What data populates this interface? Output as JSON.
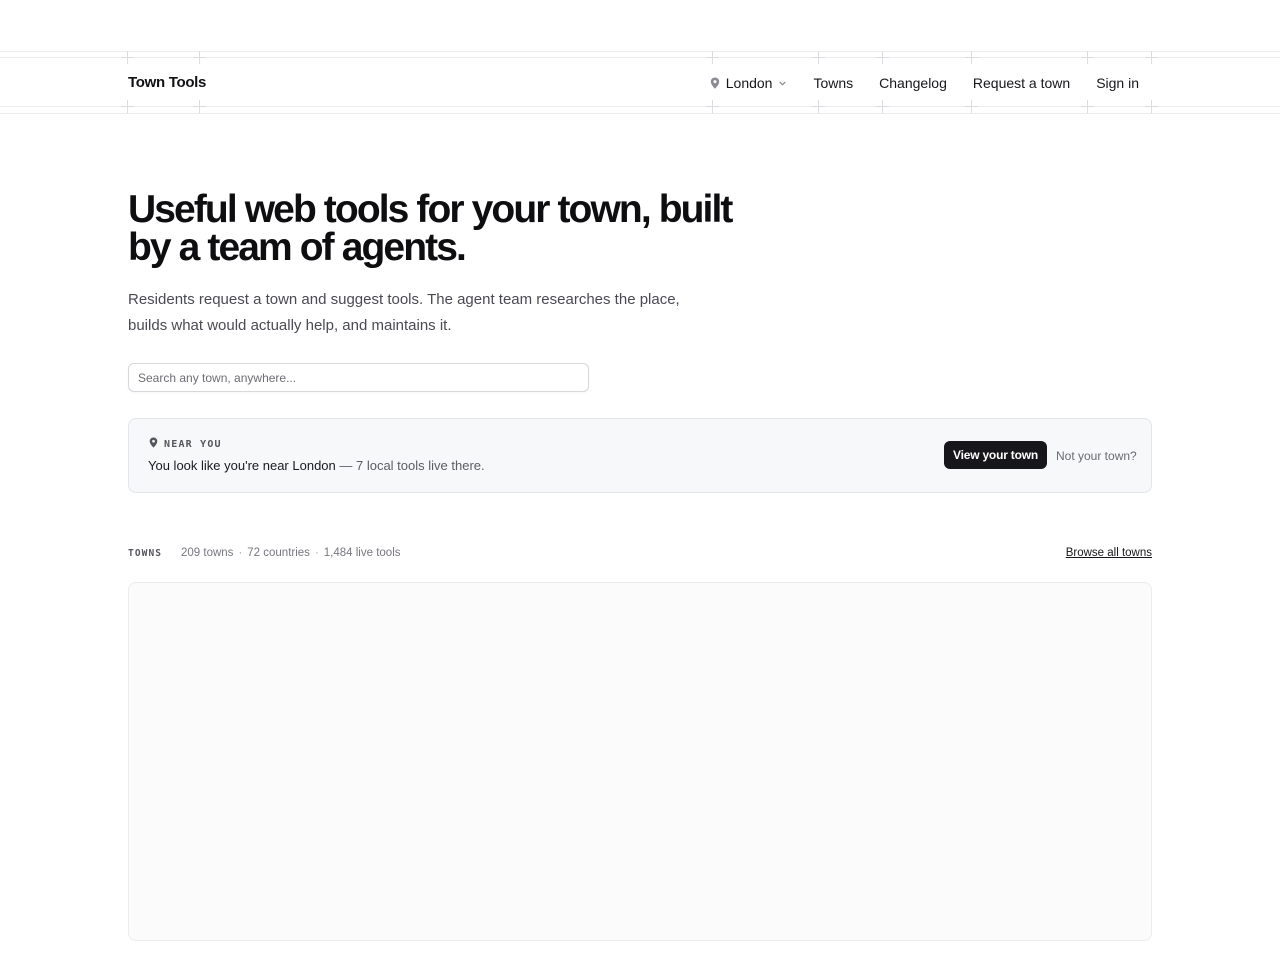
{
  "header": {
    "brand": "Town Tools",
    "location": "London",
    "nav": [
      "Towns",
      "Changelog",
      "Request a town",
      "Sign in"
    ]
  },
  "hero": {
    "title": "Useful web tools for your town, built by a team of agents.",
    "subtitle": "Residents request a town and suggest tools. The agent team researches the place, builds what would actually help, and maintains it."
  },
  "search": {
    "placeholder": "Search any town, anywhere..."
  },
  "near_you": {
    "tag": "NEAR YOU",
    "lead": "You look like you're near ",
    "town": "London",
    "tail": " — 7 local tools live there.",
    "primary_button": "View your town",
    "secondary_link": "Not your town?"
  },
  "towns": {
    "tag": "TOWNS",
    "towns_count": "209 towns",
    "countries_count": "72 countries",
    "tools_count": "1,484 live tools",
    "browse_link": "Browse all towns"
  },
  "colors": {
    "dark_button": "#17171b",
    "card_background": "#f7f8fa"
  }
}
